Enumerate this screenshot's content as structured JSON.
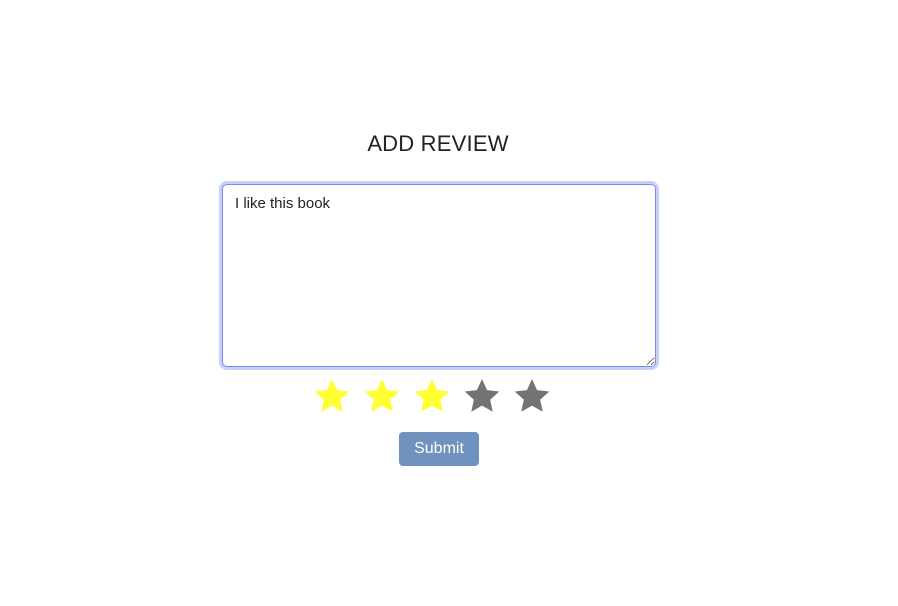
{
  "page": {
    "title": "ADD REVIEW"
  },
  "review": {
    "text": "I like this book"
  },
  "rating": {
    "value": 3,
    "max": 5,
    "filled_color": "#ffff33",
    "empty_color": "#737373",
    "icon": "star-icon"
  },
  "actions": {
    "submit_label": "Submit",
    "submit_color": "#6f92be"
  }
}
